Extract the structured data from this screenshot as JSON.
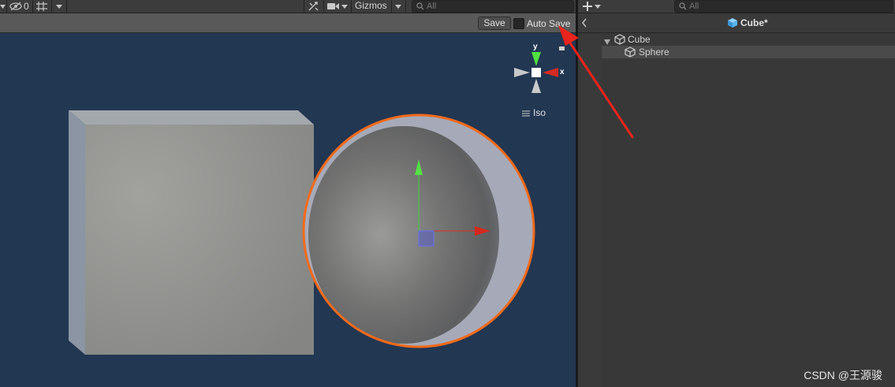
{
  "scene_toolbar": {
    "hidden_count": "0",
    "gizmos_label": "Gizmos",
    "search_placeholder": "All"
  },
  "prefab_bar": {
    "save_label": "Save",
    "auto_save_label": "Auto Save",
    "auto_save_checked": false
  },
  "scene_gizmo": {
    "y_label": "y",
    "x_label": "x",
    "projection_label": "Iso"
  },
  "hierarchy": {
    "search_placeholder": "All",
    "prefab_title": "Cube*",
    "items": [
      {
        "label": "Cube",
        "expanded": true,
        "depth": 0
      },
      {
        "label": "Sphere",
        "selected": true,
        "depth": 1
      }
    ]
  },
  "watermark": "CSDN @王源骏",
  "colors": {
    "scene_background": "#223752",
    "selection_outline": "#f26a1b",
    "annotation_arrow": "#e8241c",
    "prefab_icon": "#5ab4ea"
  }
}
